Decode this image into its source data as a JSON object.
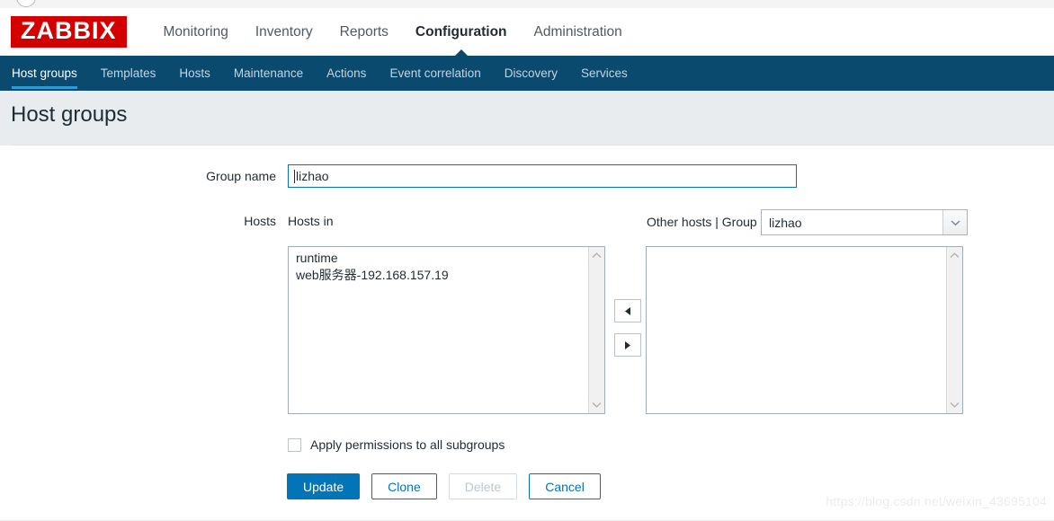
{
  "browser": {
    "tab_circle_icon": "circle-icon"
  },
  "header": {
    "logo_text": "ZABBIX",
    "logo_color": "#d40000",
    "menu": [
      {
        "label": "Monitoring",
        "selected": false
      },
      {
        "label": "Inventory",
        "selected": false
      },
      {
        "label": "Reports",
        "selected": false
      },
      {
        "label": "Configuration",
        "selected": true
      },
      {
        "label": "Administration",
        "selected": false
      }
    ]
  },
  "subnav": {
    "background": "#0a4a6e",
    "accent": "#2e9bd6",
    "items": [
      {
        "label": "Host groups",
        "selected": true
      },
      {
        "label": "Templates",
        "selected": false
      },
      {
        "label": "Hosts",
        "selected": false
      },
      {
        "label": "Maintenance",
        "selected": false
      },
      {
        "label": "Actions",
        "selected": false
      },
      {
        "label": "Event correlation",
        "selected": false
      },
      {
        "label": "Discovery",
        "selected": false
      },
      {
        "label": "Services",
        "selected": false
      }
    ]
  },
  "page": {
    "title": "Host groups"
  },
  "form": {
    "group_name": {
      "label": "Group name",
      "value": "lizhao",
      "focused": true
    },
    "hosts": {
      "label": "Hosts",
      "hosts_in_label": "Hosts in",
      "other_hosts_label": "Other hosts | Group",
      "group_select": {
        "value": "lizhao",
        "arrow_icon": "chevron-down-icon"
      },
      "hosts_in_items": [
        "runtime",
        "web服务器-192.168.157.19"
      ],
      "other_hosts_items": [],
      "transfer_left_icon": "triangle-left-icon",
      "transfer_right_icon": "triangle-right-icon",
      "scroll_up_icon": "chevron-up-icon",
      "scroll_down_icon": "chevron-down-icon"
    },
    "subgroups_checkbox": {
      "label": "Apply permissions to all subgroups",
      "checked": false
    },
    "buttons": [
      {
        "label": "Update",
        "style": "primary",
        "enabled": true
      },
      {
        "label": "Clone",
        "style": "secondary",
        "enabled": true
      },
      {
        "label": "Delete",
        "style": "disabled",
        "enabled": false
      },
      {
        "label": "Cancel",
        "style": "secondary",
        "enabled": true
      }
    ],
    "accent_color": "#0275b8"
  },
  "watermark": {
    "text": "https://blog.csdn.net/weixin_43695104"
  }
}
